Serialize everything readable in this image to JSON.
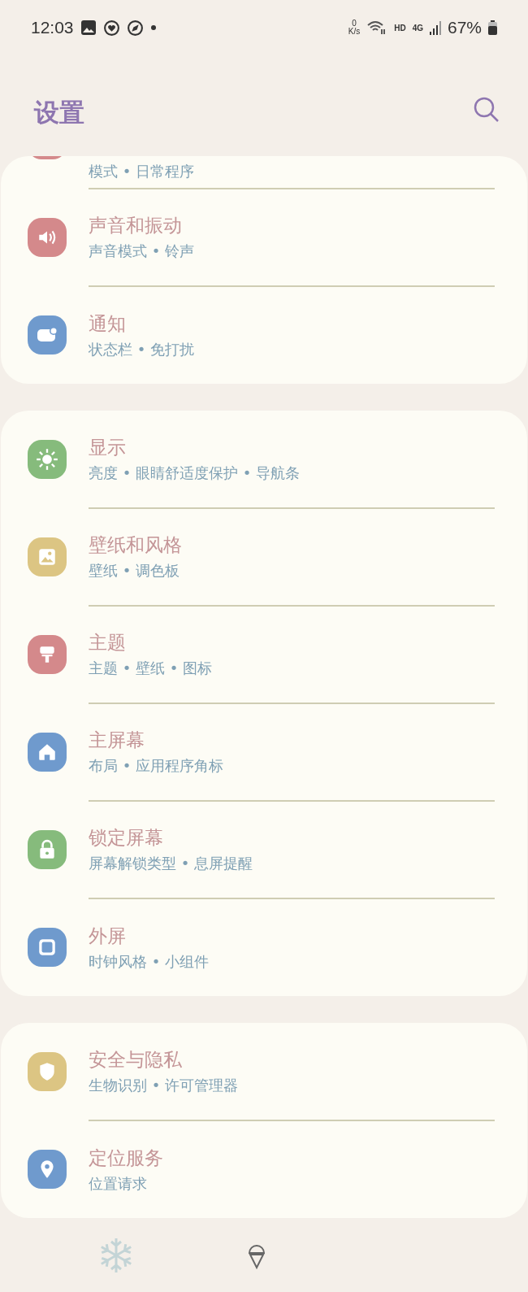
{
  "status_bar": {
    "time": "12:03",
    "net_speed_value": "0",
    "net_speed_unit": "K/s",
    "hd": "HD",
    "network": "4G",
    "battery": "67%"
  },
  "header": {
    "title": "设置"
  },
  "groups": [
    {
      "items": [
        {
          "subtitle": "模式 • 日常程序",
          "color": "#d4898b",
          "cut": true
        },
        {
          "title": "声音和振动",
          "subtitle": "声音模式 • 铃声",
          "color": "#d4898b",
          "cut": false
        },
        {
          "title": "通知",
          "subtitle": "状态栏 • 免打扰",
          "color": "#6f9acd",
          "cut": false
        }
      ]
    },
    {
      "items": [
        {
          "title": "显示",
          "subtitle": "亮度 • 眼睛舒适度保护 • 导航条",
          "color": "#86bb7c",
          "cut": false
        },
        {
          "title": "壁纸和风格",
          "subtitle": "壁纸 • 调色板",
          "color": "#dcc583",
          "cut": false
        },
        {
          "title": "主题",
          "subtitle": "主题 • 壁纸 • 图标",
          "color": "#d4898b",
          "cut": false
        },
        {
          "title": "主屏幕",
          "subtitle": "布局 • 应用程序角标",
          "color": "#6f9acd",
          "cut": false
        },
        {
          "title": "锁定屏幕",
          "subtitle": "屏幕解锁类型 • 息屏提醒",
          "color": "#86bb7c",
          "cut": false
        },
        {
          "title": "外屏",
          "subtitle": "时钟风格 • 小组件",
          "color": "#6f9acd",
          "cut": false
        }
      ]
    },
    {
      "items": [
        {
          "title": "安全与隐私",
          "subtitle": "生物识别 • 许可管理器",
          "color": "#dcc583",
          "cut": false
        },
        {
          "title": "定位服务",
          "subtitle": "位置请求",
          "color": "#6f9acd",
          "cut": false
        }
      ]
    }
  ]
}
